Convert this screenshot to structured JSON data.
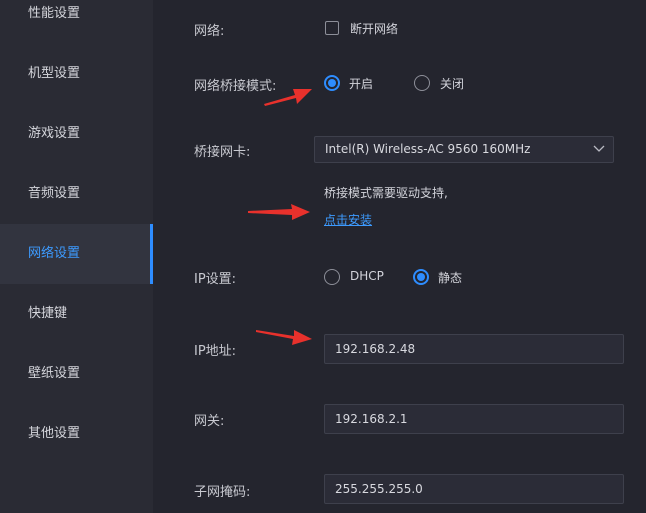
{
  "sidebar": {
    "items": [
      {
        "label": "性能设置"
      },
      {
        "label": "机型设置"
      },
      {
        "label": "游戏设置"
      },
      {
        "label": "音频设置"
      },
      {
        "label": "网络设置"
      },
      {
        "label": "快捷键"
      },
      {
        "label": "壁纸设置"
      },
      {
        "label": "其他设置"
      }
    ],
    "active_index": 4
  },
  "network": {
    "label": "网络:",
    "disconnect_label": "断开网络",
    "disconnect_checked": false
  },
  "bridge_mode": {
    "label": "网络桥接模式:",
    "options": [
      "开启",
      "关闭"
    ],
    "selected": "开启"
  },
  "bridge_nic": {
    "label": "桥接网卡:",
    "value": "Intel(R) Wireless-AC 9560 160MHz"
  },
  "driver_notice": {
    "text": "桥接模式需要驱动支持,",
    "install_link": "点击安装"
  },
  "ip_settings": {
    "label": "IP设置:",
    "options": [
      "DHCP",
      "静态"
    ],
    "selected": "静态"
  },
  "ip_address": {
    "label": "IP地址:",
    "value": "192.168.2.48"
  },
  "gateway": {
    "label": "网关:",
    "value": "192.168.2.1"
  },
  "subnet_mask": {
    "label": "子网掩码:",
    "value": "255.255.255.0"
  },
  "colors": {
    "accent": "#2e8dff",
    "annotation_arrow": "#e8312c",
    "background": "#24252e",
    "sidebar": "#2a2b34"
  },
  "icons": {
    "select_arrow": "chevron-down-icon",
    "annotation": "red-arrow-icon"
  }
}
